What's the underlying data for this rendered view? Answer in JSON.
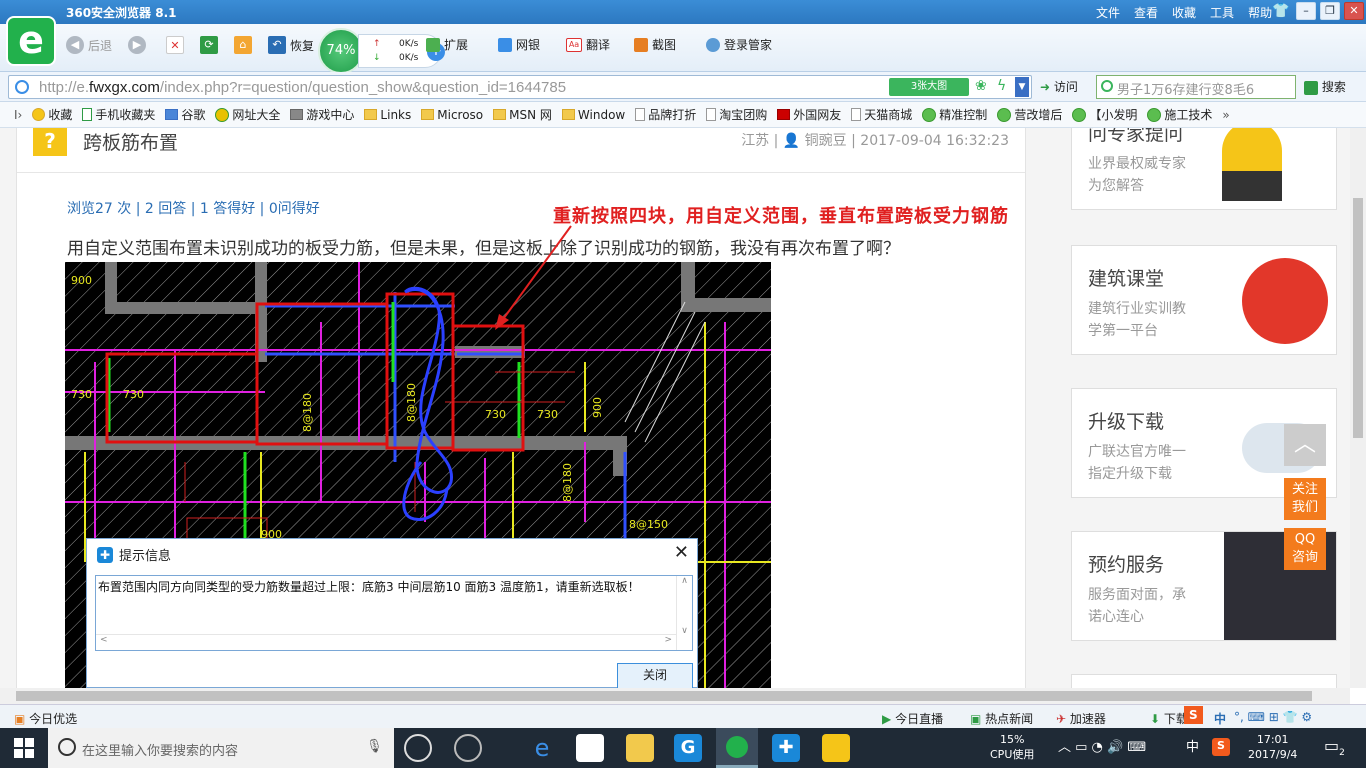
{
  "browser": {
    "title": "360安全浏览器 8.1",
    "menus": [
      "文件",
      "查看",
      "收藏",
      "工具",
      "帮助"
    ],
    "toolbar": {
      "back": "后退",
      "restore": "恢复",
      "extend": "扩展",
      "netbank": "网银",
      "translate": "翻译",
      "screenshot": "截图",
      "login": "登录管家"
    },
    "speed": {
      "percent": "74%",
      "up": "0K/s",
      "down": "0K/s"
    },
    "url_prefix": "http://e.",
    "url_domain": "fwxgx.com",
    "url_rest": "/index.php?r=question/question_show&question_id=1644785",
    "big_image": "3张大图",
    "visit": "访问",
    "search_placeholder": "男子1万6存建行变8毛6",
    "search_button": "搜索",
    "favorites": [
      "收藏",
      "手机收藏夹",
      "谷歌",
      "网址大全",
      "游戏中心",
      "Links",
      "Microso",
      "MSN 网",
      "Window",
      "品牌打折",
      "淘宝团购",
      "外国网友",
      "天猫商城",
      "精准控制",
      "营改增后",
      "【小发明",
      "施工技术"
    ]
  },
  "question": {
    "title": "跨板筋布置",
    "meta": "江苏 | 👤 铜豌豆 | 2017-09-04 16:32:23",
    "stats": "浏览27 次 | 2 回答 | 1 答得好 | 0问得好",
    "annotation": "重新按照四块，用自定义范围，垂直布置跨板受力钢筋",
    "body": "用自定义范围布置未识别成功的板受力筋，但是未果，但是这板上除了识别成功的钢筋，我没有再次布置了啊？"
  },
  "cad_labels": [
    "900",
    "730",
    "730",
    "730",
    "730",
    "8@180",
    "8@180",
    "900",
    "900",
    "8@180",
    "8@150"
  ],
  "dialog": {
    "title": "提示信息",
    "message": "布置范围内同方向同类型的受力筋数量超过上限：底筋3 中间层筋10 面筋3 温度筋1，请重新选取板！",
    "ok": "关闭"
  },
  "sidebar": [
    {
      "title": "问专家提问",
      "line1": "业界最权威专家",
      "line2": "为您解答"
    },
    {
      "title": "建筑课堂",
      "line1": "建筑行业实训教",
      "line2": "学第一平台"
    },
    {
      "title": "升级下载",
      "line1": "广联达官方唯一",
      "line2": "指定升级下载"
    },
    {
      "title": "预约服务",
      "line1": "服务面对面，承",
      "line2": "诺心连心"
    }
  ],
  "float": {
    "follow": "关注\n我们",
    "follow1": "关注",
    "follow2": "我们",
    "qq1": "QQ",
    "qq2": "咨询"
  },
  "statusbar": {
    "today": "今日优选",
    "live": "今日直播",
    "hot": "热点新闻",
    "accel": "加速器",
    "download": "下载",
    "ime": "中"
  },
  "taskbar": {
    "search_placeholder": "在这里输入你要搜索的内容",
    "cpu_percent": "15%",
    "cpu_label": "CPU使用",
    "ime": "中",
    "time": "17:01",
    "date": "2017/9/4",
    "notif": "2"
  },
  "colors": {
    "accent": "#2c78c0",
    "green": "#22b14c",
    "red": "#e02020",
    "orange": "#f37b1d",
    "link": "#2a6db3"
  }
}
